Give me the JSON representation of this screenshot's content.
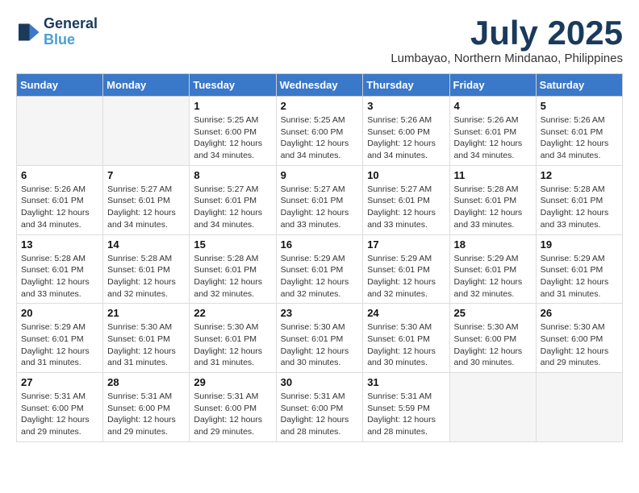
{
  "header": {
    "logo_line1": "General",
    "logo_line2": "Blue",
    "month_title": "July 2025",
    "subtitle": "Lumbayao, Northern Mindanao, Philippines"
  },
  "weekdays": [
    "Sunday",
    "Monday",
    "Tuesday",
    "Wednesday",
    "Thursday",
    "Friday",
    "Saturday"
  ],
  "weeks": [
    [
      {
        "day": "",
        "info": ""
      },
      {
        "day": "",
        "info": ""
      },
      {
        "day": "1",
        "info": "Sunrise: 5:25 AM\nSunset: 6:00 PM\nDaylight: 12 hours\nand 34 minutes."
      },
      {
        "day": "2",
        "info": "Sunrise: 5:25 AM\nSunset: 6:00 PM\nDaylight: 12 hours\nand 34 minutes."
      },
      {
        "day": "3",
        "info": "Sunrise: 5:26 AM\nSunset: 6:00 PM\nDaylight: 12 hours\nand 34 minutes."
      },
      {
        "day": "4",
        "info": "Sunrise: 5:26 AM\nSunset: 6:01 PM\nDaylight: 12 hours\nand 34 minutes."
      },
      {
        "day": "5",
        "info": "Sunrise: 5:26 AM\nSunset: 6:01 PM\nDaylight: 12 hours\nand 34 minutes."
      }
    ],
    [
      {
        "day": "6",
        "info": "Sunrise: 5:26 AM\nSunset: 6:01 PM\nDaylight: 12 hours\nand 34 minutes."
      },
      {
        "day": "7",
        "info": "Sunrise: 5:27 AM\nSunset: 6:01 PM\nDaylight: 12 hours\nand 34 minutes."
      },
      {
        "day": "8",
        "info": "Sunrise: 5:27 AM\nSunset: 6:01 PM\nDaylight: 12 hours\nand 34 minutes."
      },
      {
        "day": "9",
        "info": "Sunrise: 5:27 AM\nSunset: 6:01 PM\nDaylight: 12 hours\nand 33 minutes."
      },
      {
        "day": "10",
        "info": "Sunrise: 5:27 AM\nSunset: 6:01 PM\nDaylight: 12 hours\nand 33 minutes."
      },
      {
        "day": "11",
        "info": "Sunrise: 5:28 AM\nSunset: 6:01 PM\nDaylight: 12 hours\nand 33 minutes."
      },
      {
        "day": "12",
        "info": "Sunrise: 5:28 AM\nSunset: 6:01 PM\nDaylight: 12 hours\nand 33 minutes."
      }
    ],
    [
      {
        "day": "13",
        "info": "Sunrise: 5:28 AM\nSunset: 6:01 PM\nDaylight: 12 hours\nand 33 minutes."
      },
      {
        "day": "14",
        "info": "Sunrise: 5:28 AM\nSunset: 6:01 PM\nDaylight: 12 hours\nand 32 minutes."
      },
      {
        "day": "15",
        "info": "Sunrise: 5:28 AM\nSunset: 6:01 PM\nDaylight: 12 hours\nand 32 minutes."
      },
      {
        "day": "16",
        "info": "Sunrise: 5:29 AM\nSunset: 6:01 PM\nDaylight: 12 hours\nand 32 minutes."
      },
      {
        "day": "17",
        "info": "Sunrise: 5:29 AM\nSunset: 6:01 PM\nDaylight: 12 hours\nand 32 minutes."
      },
      {
        "day": "18",
        "info": "Sunrise: 5:29 AM\nSunset: 6:01 PM\nDaylight: 12 hours\nand 32 minutes."
      },
      {
        "day": "19",
        "info": "Sunrise: 5:29 AM\nSunset: 6:01 PM\nDaylight: 12 hours\nand 31 minutes."
      }
    ],
    [
      {
        "day": "20",
        "info": "Sunrise: 5:29 AM\nSunset: 6:01 PM\nDaylight: 12 hours\nand 31 minutes."
      },
      {
        "day": "21",
        "info": "Sunrise: 5:30 AM\nSunset: 6:01 PM\nDaylight: 12 hours\nand 31 minutes."
      },
      {
        "day": "22",
        "info": "Sunrise: 5:30 AM\nSunset: 6:01 PM\nDaylight: 12 hours\nand 31 minutes."
      },
      {
        "day": "23",
        "info": "Sunrise: 5:30 AM\nSunset: 6:01 PM\nDaylight: 12 hours\nand 30 minutes."
      },
      {
        "day": "24",
        "info": "Sunrise: 5:30 AM\nSunset: 6:01 PM\nDaylight: 12 hours\nand 30 minutes."
      },
      {
        "day": "25",
        "info": "Sunrise: 5:30 AM\nSunset: 6:00 PM\nDaylight: 12 hours\nand 30 minutes."
      },
      {
        "day": "26",
        "info": "Sunrise: 5:30 AM\nSunset: 6:00 PM\nDaylight: 12 hours\nand 29 minutes."
      }
    ],
    [
      {
        "day": "27",
        "info": "Sunrise: 5:31 AM\nSunset: 6:00 PM\nDaylight: 12 hours\nand 29 minutes."
      },
      {
        "day": "28",
        "info": "Sunrise: 5:31 AM\nSunset: 6:00 PM\nDaylight: 12 hours\nand 29 minutes."
      },
      {
        "day": "29",
        "info": "Sunrise: 5:31 AM\nSunset: 6:00 PM\nDaylight: 12 hours\nand 29 minutes."
      },
      {
        "day": "30",
        "info": "Sunrise: 5:31 AM\nSunset: 6:00 PM\nDaylight: 12 hours\nand 28 minutes."
      },
      {
        "day": "31",
        "info": "Sunrise: 5:31 AM\nSunset: 5:59 PM\nDaylight: 12 hours\nand 28 minutes."
      },
      {
        "day": "",
        "info": ""
      },
      {
        "day": "",
        "info": ""
      }
    ]
  ]
}
